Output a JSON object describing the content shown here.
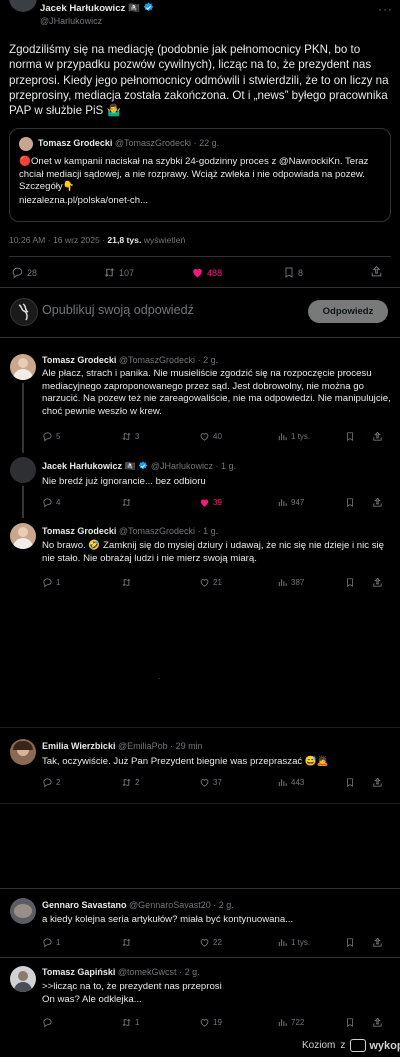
{
  "main_tweet": {
    "author_name": "Jacek Harłukowicz",
    "author_emoji": "🏴‍☠️",
    "author_handle": "@JHarlukowicz",
    "text": "Zgodziliśmy się na mediację (podobnie jak pełnomocnicy PKN, bo to norma w przypadku pozwów cywilnych), licząc na to, że prezydent nas przeprosi. Kiedy jego pełnomocnicy odmówili i stwierdzili, że to on liczy na przeprosiny, mediacja została zakończona. Ot i „news” byłego pracownika PAP w służbie PiS 🤷‍♂️",
    "quote": {
      "author_name": "Tomasz Grodecki",
      "author_handle": "@TomaszGrodecki",
      "time": "22 g.",
      "text": "🔴Onet w kampanii naciskał na szybki 24-godzinny proces z @NawrockiKn. Teraz chciał mediacji sądowej, a nie rozprawy. Wciąż zwleka i nie odpowiada na pozew. Szczegóły👇",
      "link": "niezalezna.pl/polska/onet-ch..."
    },
    "timestamp": "10:26 AM · 16 wrz 2025 · ",
    "views_count": "21,8 tys.",
    "views_label": " wyświetleń",
    "metrics": {
      "replies": "28",
      "reposts": "107",
      "likes": "488",
      "bookmarks": "8"
    }
  },
  "reply_box": {
    "placeholder": "Opublikuj swoją odpowiedź",
    "button_label": "Odpowiedz"
  },
  "replies": [
    {
      "author_name": "Tomasz Grodecki",
      "author_handle": "@TomaszGrodecki",
      "time": "2 g.",
      "text": "Ale płacz, strach i panika. Nie musieliście zgodzić się na rozpoczęcie procesu mediacyjnego zaproponowanego przez sąd. Jest dobrowolny, nie można go narzucić. Na pozew też nie zareagowaliście, nie ma odpowiedzi. Nie manipulujcie, choć pewnie weszło w krew.",
      "metrics": {
        "replies": "5",
        "reposts": "3",
        "likes": "40",
        "views": "1 tys."
      }
    },
    {
      "author_name": "Jacek Harłukowicz",
      "author_emoji": "🏴‍☠️",
      "author_handle": "@JHarlukowicz",
      "time": "1 g.",
      "text": "Nie bredź już ignorancie... bez odbioru",
      "metrics": {
        "replies": "4",
        "reposts": "",
        "likes": "39",
        "views": "947"
      }
    },
    {
      "author_name": "Tomasz Grodecki",
      "author_handle": "@TomaszGrodecki",
      "time": "1 g.",
      "text": "No brawo. 🤣 Zamknij się do mysiej dziury i udawaj, że nic się nie dzieje i nic się nie stało. Nie obrażaj ludzi i nie mierz swoją miarą.",
      "metrics": {
        "replies": "1",
        "reposts": "",
        "likes": "21",
        "views": "387"
      }
    },
    {
      "author_name": "Emilia Wierzbicki",
      "author_handle": "@EmiliaPob",
      "time": "29 min",
      "text": "Tak, oczywiście. Już Pan Prezydent biegnie was przepraszać 😅🙇",
      "metrics": {
        "replies": "2",
        "reposts": "2",
        "likes": "37",
        "views": "443"
      }
    },
    {
      "author_name": "Gennaro Savastano",
      "author_handle": "@GennaroSavast20",
      "time": "2 g.",
      "text": "a kiedy kolejna seria artykułów? miała być kontynuowana...",
      "metrics": {
        "replies": "1",
        "reposts": "",
        "likes": "22",
        "views": "1 tys."
      }
    },
    {
      "author_name": "Tomasz Gapiński",
      "author_handle": "@tomekGwcst",
      "time": "2 g.",
      "text_line1": ">>licząc na to, że prezydent nas przeprosi",
      "text_line2": "On was? Ale odklejka...",
      "metrics": {
        "replies": "",
        "reposts": "1",
        "likes": "19",
        "views": "722"
      }
    }
  ],
  "footer": {
    "brand_text": "Koziom",
    "z": "z",
    "wykop": "wykop.pl"
  },
  "colors": {
    "background": "#000000",
    "text": "#e7e9ea",
    "muted": "#71767b",
    "like": "#f91880",
    "verified": "#1d9bf0",
    "separator": "#2f3336"
  }
}
